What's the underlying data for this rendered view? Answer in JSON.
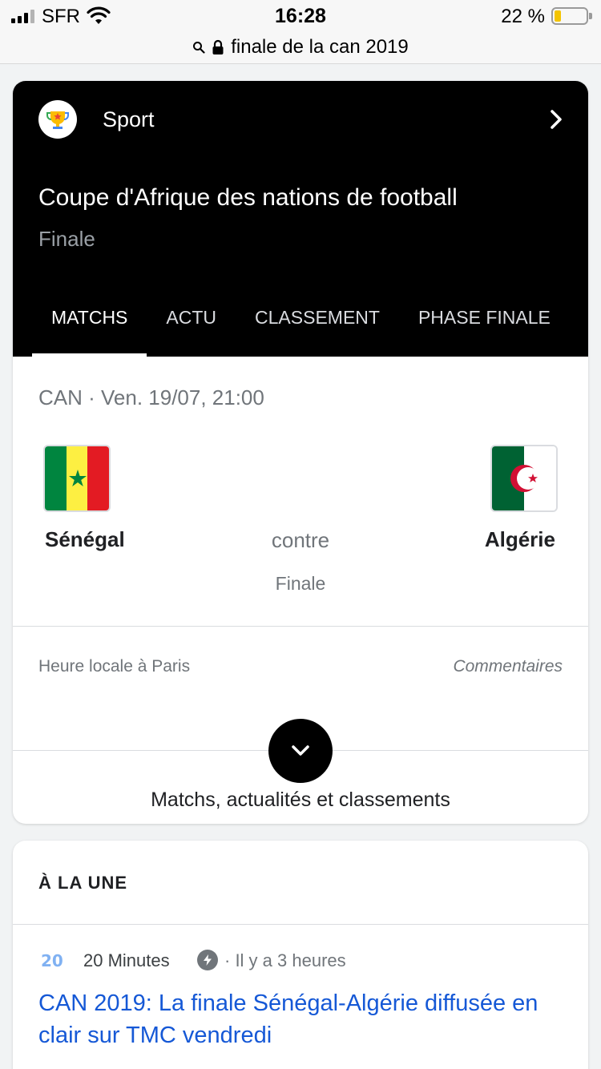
{
  "status_bar": {
    "carrier": "SFR",
    "time": "16:28",
    "battery_percent": "22 %",
    "battery_level": 0.22
  },
  "url_bar": {
    "url": "finale de la can 2019",
    "icons": [
      "search-icon",
      "lock-icon"
    ]
  },
  "sport_card": {
    "category": "Sport",
    "competition_title": "Coupe d'Afrique des nations de football",
    "competition_subtitle": "Finale",
    "tabs": [
      {
        "label": "MATCHS",
        "active": true
      },
      {
        "label": "ACTU",
        "active": false
      },
      {
        "label": "CLASSEMENT",
        "active": false
      },
      {
        "label": "PHASE FINALE",
        "active": false
      }
    ],
    "match": {
      "meta": "CAN · Ven. 19/07, 21:00",
      "home_team": "Sénégal",
      "away_team": "Algérie",
      "versus": "contre",
      "stage": "Finale"
    },
    "local_time_note": "Heure locale à Paris",
    "comments_label": "Commentaires",
    "more_label": "Matchs, actualités et classements"
  },
  "news_card": {
    "heading": "À LA UNE",
    "source_name": "20 Minutes",
    "time_ago": "· Il y a 3 heures",
    "headline": "CAN 2019: La finale Sénégal-Algérie diffusée en clair sur TMC vendredi"
  },
  "colors": {
    "header_bg": "#000000",
    "link_blue": "#1558d6",
    "muted_text": "#70757a",
    "battery_yellow": "#f4c400"
  }
}
